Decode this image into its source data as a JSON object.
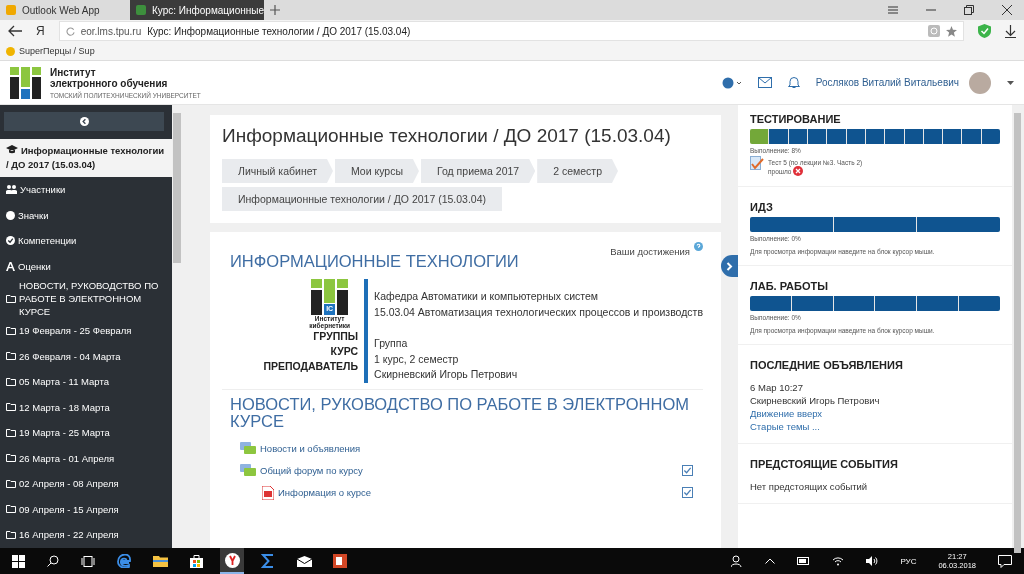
{
  "browser": {
    "tabs": [
      {
        "title": "Outlook Web App",
        "selected": false
      },
      {
        "title": "Курс: Информационные",
        "selected": true
      }
    ],
    "address": {
      "domain": "eor.lms.tpu.ru",
      "title": "Курс: Информационные технологии / ДО 2017 (15.03.04)"
    },
    "yandex_letter": "Я",
    "bookmarks": [
      "SuperПерцы / Sup"
    ]
  },
  "header": {
    "logo_lines": [
      "Институт",
      "электронного обучения"
    ],
    "logo_sub": "ТОМСКИЙ ПОЛИТЕХНИЧЕСКИЙ УНИВЕРСИТЕТ",
    "user": "Росляков Виталий Витальевич"
  },
  "sidebar": {
    "course": {
      "label": "Информационные технологии / ДО 2017 (15.03.04)",
      "selected": true
    },
    "items": [
      {
        "label": "Участники",
        "kind": "people"
      },
      {
        "label": "Значки",
        "kind": "badge"
      },
      {
        "label": "Компетенции",
        "kind": "check"
      },
      {
        "label": "Оценки",
        "kind": "grades"
      },
      {
        "label": "НОВОСТИ, РУКОВОДСТВО ПО РАБОТЕ В ЭЛЕКТРОННОМ КУРСЕ",
        "kind": "folder"
      },
      {
        "label": "19 Февраля - 25 Февраля",
        "kind": "folder"
      },
      {
        "label": "26 Февраля - 04 Марта",
        "kind": "folder"
      },
      {
        "label": "05 Марта - 11 Марта",
        "kind": "folder"
      },
      {
        "label": "12 Марта - 18 Марта",
        "kind": "folder"
      },
      {
        "label": "19 Марта - 25 Марта",
        "kind": "folder"
      },
      {
        "label": "26 Марта - 01 Апреля",
        "kind": "folder"
      },
      {
        "label": "02 Апреля - 08 Апреля",
        "kind": "folder"
      },
      {
        "label": "09 Апреля - 15 Апреля",
        "kind": "folder"
      },
      {
        "label": "16 Апреля - 22 Апреля",
        "kind": "folder"
      }
    ]
  },
  "course": {
    "title": "Информационные технологии / ДО 2017 (15.03.04)",
    "breadcrumbs": [
      "Личный кабинет",
      "Мои курсы",
      "Год приема 2017",
      "2 семестр"
    ],
    "current": "Информационные технологии / ДО 2017 (15.03.04)"
  },
  "section": {
    "heading": "ИНФОРМАЦИОННЫЕ ТЕХНОЛОГИИ",
    "achievements": "Ваши достижения",
    "logo_lines": [
      "Институт",
      "кибернетики"
    ],
    "logo_letters": "IC",
    "department": "Кафедра Автоматики и компьютерных систем",
    "program": "15.03.04  Автоматизация технологических процессов и производств",
    "rows": [
      {
        "label": "ГРУППЫ",
        "value": "Группа"
      },
      {
        "label": "КУРС",
        "value": "1 курс, 2 семестр"
      },
      {
        "label": "ПРЕПОДАВАТЕЛЬ",
        "value": "Скирневский Игорь Петрович"
      }
    ]
  },
  "news": {
    "heading": "НОВОСТИ, РУКОВОДСТВО ПО РАБОТЕ В ЭЛЕКТРОННОМ КУРСЕ",
    "items": [
      {
        "label": "Новости и объявления",
        "kind": "forum",
        "tracked": false
      },
      {
        "label": "Общий форум по курсу",
        "kind": "forum",
        "tracked": true,
        "checked": true
      },
      {
        "label": "Информация о курсе",
        "kind": "pdf",
        "tracked": true,
        "checked": true
      }
    ]
  },
  "blocks": [
    {
      "kind": "progress",
      "title": "ТЕСТИРОВАНИЕ",
      "segments": [
        {
          "done": true
        },
        {
          "done": false
        },
        {
          "done": false
        },
        {
          "done": false
        },
        {
          "done": false
        },
        {
          "done": false
        },
        {
          "done": false
        },
        {
          "done": false
        },
        {
          "done": false
        },
        {
          "done": false
        },
        {
          "done": false
        },
        {
          "done": false
        },
        {
          "done": false
        }
      ],
      "completion": "Выполнение: 8%",
      "activity": {
        "title": "Тест 5 (по лекции №3. Часть 2)",
        "status": "прошло",
        "failed": true
      }
    },
    {
      "kind": "progress",
      "title": "ИДЗ",
      "segments": [
        {
          "done": false
        },
        {
          "done": false
        },
        {
          "done": false
        }
      ],
      "completion": "Выполнение: 0%",
      "hint": "Для просмотра информации наведите на блок курсор мыши."
    },
    {
      "kind": "progress",
      "title": "ЛАБ. РАБОТЫ",
      "segments": [
        {
          "done": false
        },
        {
          "done": false
        },
        {
          "done": false
        },
        {
          "done": false
        },
        {
          "done": false
        },
        {
          "done": false
        }
      ],
      "completion": "Выполнение: 0%",
      "hint": "Для просмотра информации наведите на блок курсор мыши."
    },
    {
      "kind": "news",
      "title": "ПОСЛЕДНИЕ ОБЪЯВЛЕНИЯ",
      "date": "6 Мар 10:27",
      "author": "Скирневский Игорь Петрович",
      "links": [
        "Движение вверх",
        "Старые темы ..."
      ]
    },
    {
      "kind": "events",
      "title": "ПРЕДСТОЯЩИЕ СОБЫТИЯ",
      "text": "Нет предстоящих событий"
    }
  ],
  "taskbar": {
    "apps": [
      {
        "kind": "edge",
        "active": false
      },
      {
        "kind": "explorer",
        "active": false
      },
      {
        "kind": "store",
        "active": false
      },
      {
        "kind": "yandex",
        "active": true
      },
      {
        "kind": "sigma",
        "active": false
      },
      {
        "kind": "mail",
        "active": false
      },
      {
        "kind": "powerpoint",
        "active": false
      }
    ],
    "lang": "РУС",
    "time": "21:27",
    "date": "06.03.2018"
  }
}
